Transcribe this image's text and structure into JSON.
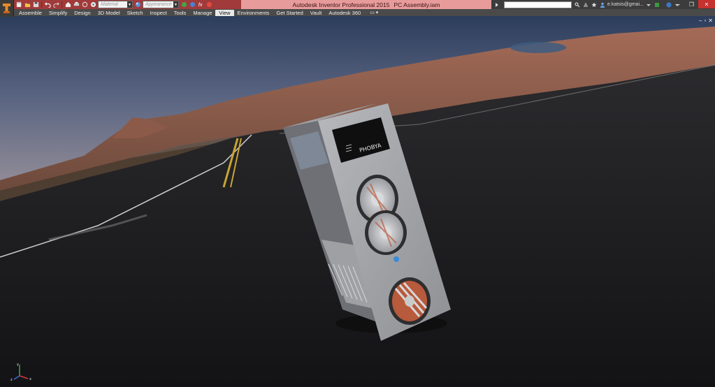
{
  "app": {
    "title": "Autodesk Inventor Professional 2015",
    "document": "PC Assembly.iam"
  },
  "quick_access": {
    "material_placeholder": "Material",
    "appearance_placeholder": "Appearance",
    "icons": [
      "new-icon",
      "open-icon",
      "save-icon",
      "undo-icon",
      "redo-icon",
      "home-icon",
      "print-icon",
      "update-icon",
      "measure-icon"
    ]
  },
  "ribbon": {
    "tabs": [
      "Assemble",
      "Simplify",
      "Design",
      "3D Model",
      "Sketch",
      "Inspect",
      "Tools",
      "Manage",
      "View",
      "Environments",
      "Get Started",
      "Vault",
      "Autodesk 360"
    ],
    "active_tab": "View",
    "extra": "▭ ▾"
  },
  "toolbar_right": {
    "user": "e.katsis@gmai...",
    "help": "?"
  },
  "window_controls": {
    "minimize": "–",
    "restore": "❐",
    "close": "✕"
  },
  "doc_controls": {
    "minimize": "–",
    "restore": "▫",
    "close": "✕"
  },
  "model": {
    "logo_text": "PHOBYA",
    "colors": {
      "case": "#a8aaae",
      "panel_dark": "#0f0f10",
      "fan_frame": "#cfd0d3",
      "fan_blades": "#b85a3c",
      "led": "#3a8ad8"
    }
  },
  "theme": {
    "title_bar": "#a13a3a",
    "title_center": "#e79b9b",
    "ribbon_bar": "#4a4a4a",
    "close_button": "#c7312e"
  }
}
